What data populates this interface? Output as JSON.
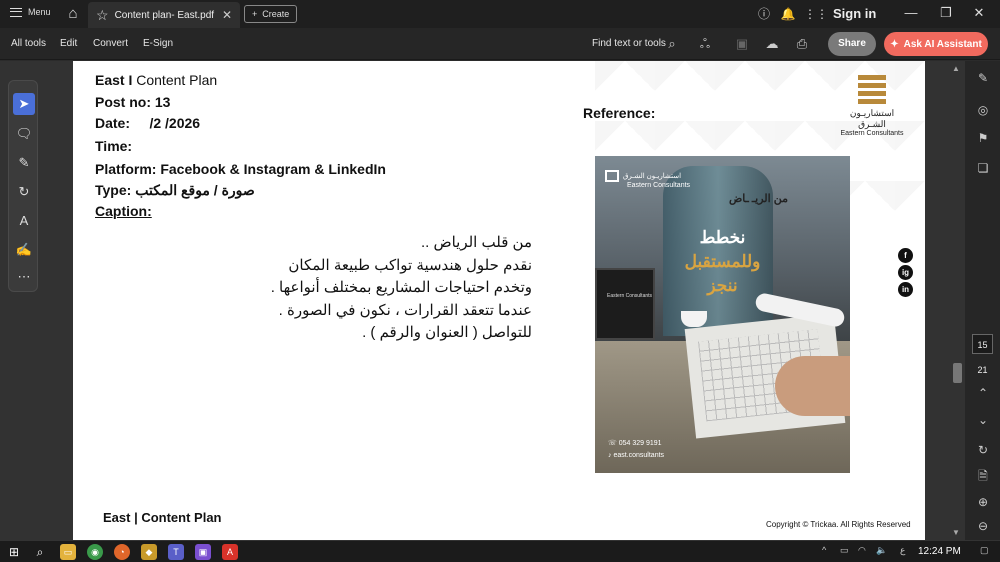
{
  "titlebar": {
    "menu_label": "Menu",
    "tab_title": "Content plan- East.pdf",
    "create_label": "Create",
    "sign_in": "Sign in"
  },
  "toolbar": {
    "all_tools": "All tools",
    "edit": "Edit",
    "convert": "Convert",
    "esign": "E-Sign",
    "find_text": "Find text or tools",
    "share": "Share",
    "ask_ai": "Ask AI Assistant"
  },
  "document": {
    "header_line1_bold": "East I",
    "header_line1_rest": " Content Plan",
    "post_no": "Post no: 13",
    "date": "Date:     /2 /2026",
    "time": "Time:",
    "platform": "Platform: Facebook & Instagram & LinkedIn",
    "type": "Type: صورة / موقع المكتب",
    "caption_label": "Caption:",
    "reference_label": "Reference:",
    "caption_lines": [
      "من قلب الرياض ..",
      "نقدم حلول هندسية تواكب طبيعة المكان",
      "وتخدم احتياجات المشاريع بمختلف أنواعها .",
      "عندما تتعقد القرارات ، نكون في الصورة .",
      "للتواصل ( العنوان والرقم ) ."
    ],
    "logo_ar": "استشاريـون الشـرق",
    "logo_en": "Eastern Consultants",
    "post": {
      "brand_ar": "استشاريـون الشـرق",
      "brand_en": "Eastern Consultants",
      "tagline": "من الريـ    ـاض",
      "headline1": "نخطط",
      "headline2": "وللمستقبل",
      "headline3": "ننجز",
      "phone": "054 329 9191",
      "handle": "east.consultants"
    },
    "social": [
      "f",
      "ig",
      "in"
    ],
    "footer_left": "East | Content Plan",
    "copyright": "Copyright © Trickaa. All Rights Reserved"
  },
  "page_nav": {
    "current_page": "15",
    "total_pages": "21"
  },
  "taskbar": {
    "time": "12:24 PM",
    "lang": "ع"
  }
}
